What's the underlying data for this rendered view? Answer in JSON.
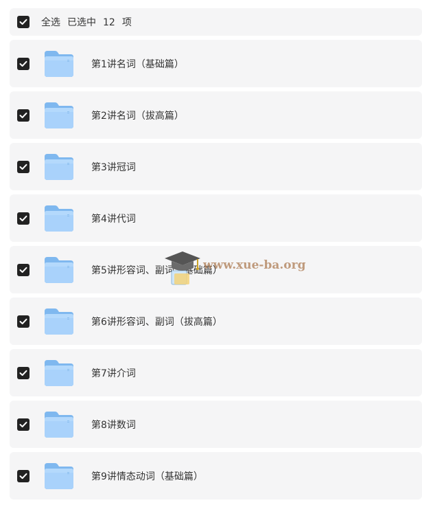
{
  "header": {
    "select_all_label": "全选",
    "selected_prefix": "已选中",
    "selected_count": "12",
    "selected_suffix": "项"
  },
  "items": [
    {
      "label": "第1讲名词（基础篇）",
      "checked": true,
      "icon": "folder-icon"
    },
    {
      "label": "第2讲名词（拔高篇）",
      "checked": true,
      "icon": "folder-icon"
    },
    {
      "label": "第3讲冠词",
      "checked": true,
      "icon": "folder-icon"
    },
    {
      "label": "第4讲代词",
      "checked": true,
      "icon": "folder-icon"
    },
    {
      "label": "第5讲形容词、副词（基础篇）",
      "checked": true,
      "icon": "folder-icon"
    },
    {
      "label": "第6讲形容词、副词（拔高篇）",
      "checked": true,
      "icon": "folder-icon"
    },
    {
      "label": "第7讲介词",
      "checked": true,
      "icon": "folder-icon"
    },
    {
      "label": "第8讲数词",
      "checked": true,
      "icon": "folder-icon"
    },
    {
      "label": "第9讲情态动词（基础篇）",
      "checked": true,
      "icon": "folder-icon"
    }
  ],
  "watermark": {
    "text": "www.xue-ba.org",
    "icon": "graduation-cap-icon"
  },
  "colors": {
    "row_background": "#f5f5f6",
    "checkbox_fill": "#222222",
    "folder_blue": "#a6d1fb",
    "text": "#333333"
  }
}
